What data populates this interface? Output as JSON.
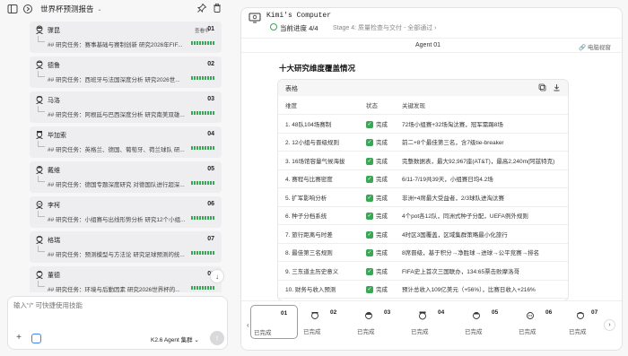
{
  "left_header": {
    "project_title": "世界杯预测报告",
    "chevron": "⌄",
    "pin_icon": "pin-icon",
    "trash_icon": "trash-icon"
  },
  "agents": [
    {
      "name": "骤昆",
      "num": "01",
      "view_label": "查看中",
      "task": "## 研究任务：赛事基础与赛制创新 研究2026年FIF...",
      "avatar_icon": "person-icon"
    },
    {
      "name": "德鲁",
      "num": "02",
      "view_label": "",
      "task": "## 研究任务：西班牙与法国深度分析 研究2026世...",
      "avatar_icon": "person-icon"
    },
    {
      "name": "马洛",
      "num": "03",
      "view_label": "",
      "task": "## 研究任务：阿根廷与巴西深度分析 研究南美双雄...",
      "avatar_icon": "person-icon"
    },
    {
      "name": "毕加索",
      "num": "04",
      "view_label": "",
      "task": "## 研究任务：英格兰、德国、葡萄牙、荷兰球队 研...",
      "avatar_icon": "person-icon"
    },
    {
      "name": "戴维",
      "num": "05",
      "view_label": "",
      "task": "## 研究任务：德国专题深度研究 对德国队进行超深...",
      "avatar_icon": "person-icon"
    },
    {
      "name": "李柯",
      "num": "06",
      "view_label": "",
      "task": "## 研究任务：小组赛与出线形势分析 研究12个小组...",
      "avatar_icon": "person-icon"
    },
    {
      "name": "格瑞",
      "num": "07",
      "view_label": "",
      "task": "## 研究任务：预测模型与方法论 研究足球预测的统...",
      "avatar_icon": "person-icon"
    },
    {
      "name": "董德",
      "num": "08",
      "view_label": "",
      "task": "## 研究任务：环境与后勤因素 研究2026世界杯的...",
      "avatar_icon": "person-icon"
    }
  ],
  "input": {
    "placeholder": "输入\"/\" 可快捷使用技能",
    "add_label": "+",
    "model_label": "K2.6 Agent 集群 ⌄",
    "send_label": "↑"
  },
  "computer": {
    "title": "Kimi's Computer",
    "progress_label": "当前进度 4/4",
    "stage_label": "Stage 4: 质量检查与交付 - 全部通过 ›",
    "agent_label": "Agent 01",
    "desktop_view_label": "电脑视窗"
  },
  "doc": {
    "heading": "十大研究维度覆盖情况",
    "table_label": "表格",
    "columns": [
      "维度",
      "状态",
      "关键发现"
    ],
    "rows": [
      [
        "1. 48队104场赛制",
        "完成",
        "72场小组赛+32场淘汰赛，冠军需踢8场"
      ],
      [
        "2. 12小组与晋级规则",
        "完成",
        "前二+8个最佳第三名，含7级tie-breaker"
      ],
      [
        "3. 16场馆容量气候海拔",
        "完成",
        "完整数据表，最大92,967座(AT&T)，最高2,240m(阿兹特克)"
      ],
      [
        "4. 赛程与比赛密度",
        "完成",
        "6/11-7/19共39天，小组赛日均4.2场"
      ],
      [
        "5. 扩军影响分析",
        "完成",
        "非洲+4席最大受益者，2/3球队进淘汰赛"
      ],
      [
        "6. 种子分档系统",
        "完成",
        "4个pot各12队，同洲式种子分配，UEFA例外规则"
      ],
      [
        "7. 旅行距离与时差",
        "完成",
        "4时区3国覆盖，区域集群策略最小化旅行"
      ],
      [
        "8. 最佳第三名规则",
        "完成",
        "8席晋级，基于积分→净胜球→进球→公平竞赛→排名"
      ],
      [
        "9. 三东道主历史意义",
        "完成",
        "FIFA史上首次三国联办，134:65票击败摩洛哥"
      ],
      [
        "10. 财务与收入预测",
        "完成",
        "预计总收入109亿美元（+56%），比赛日收入+216%"
      ]
    ]
  },
  "thumbnails": [
    {
      "num": "01",
      "status": "已完成",
      "active": true
    },
    {
      "num": "02",
      "status": "已完成",
      "active": false
    },
    {
      "num": "03",
      "status": "已完成",
      "active": false
    },
    {
      "num": "04",
      "status": "已完成",
      "active": false
    },
    {
      "num": "05",
      "status": "已完成",
      "active": false
    },
    {
      "num": "06",
      "status": "已完成",
      "active": false
    },
    {
      "num": "07",
      "status": "已完成",
      "active": false
    }
  ],
  "colors": {
    "accent_green": "#3aa757",
    "check_green": "#3aa757",
    "panel_bg": "#f7f7f8"
  }
}
